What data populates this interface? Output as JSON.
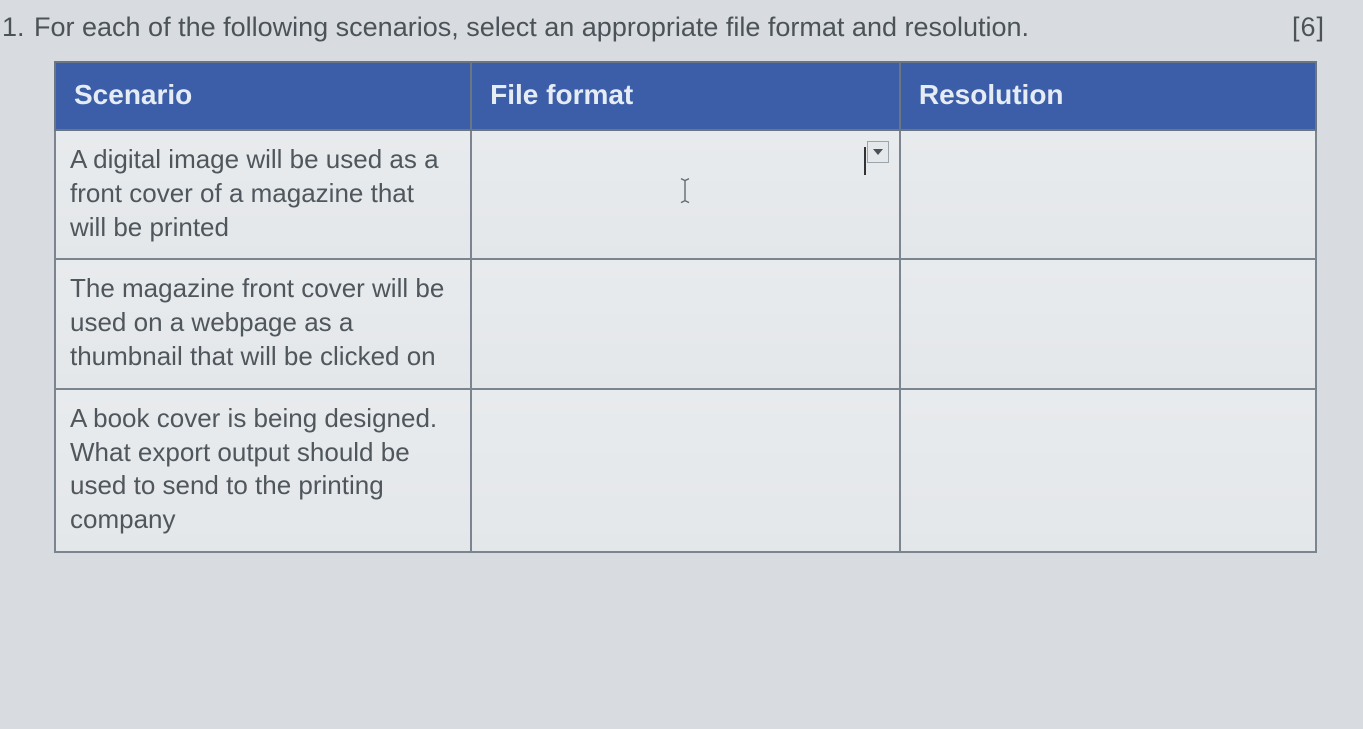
{
  "question": {
    "number": "1.",
    "text": "For each of the following scenarios, select an appropriate file format and resolution.",
    "marks": "[6]"
  },
  "table": {
    "headers": {
      "scenario": "Scenario",
      "file_format": "File format",
      "resolution": "Resolution"
    },
    "rows": [
      {
        "scenario": "A digital image will be used as a front cover of a magazine that will be printed",
        "file_format": "",
        "resolution": ""
      },
      {
        "scenario": "The magazine front cover will be used on a webpage as a thumbnail that will be clicked on",
        "file_format": "",
        "resolution": ""
      },
      {
        "scenario": "A book cover is being designed. What export output should be used to send to the printing company",
        "file_format": "",
        "resolution": ""
      }
    ]
  }
}
